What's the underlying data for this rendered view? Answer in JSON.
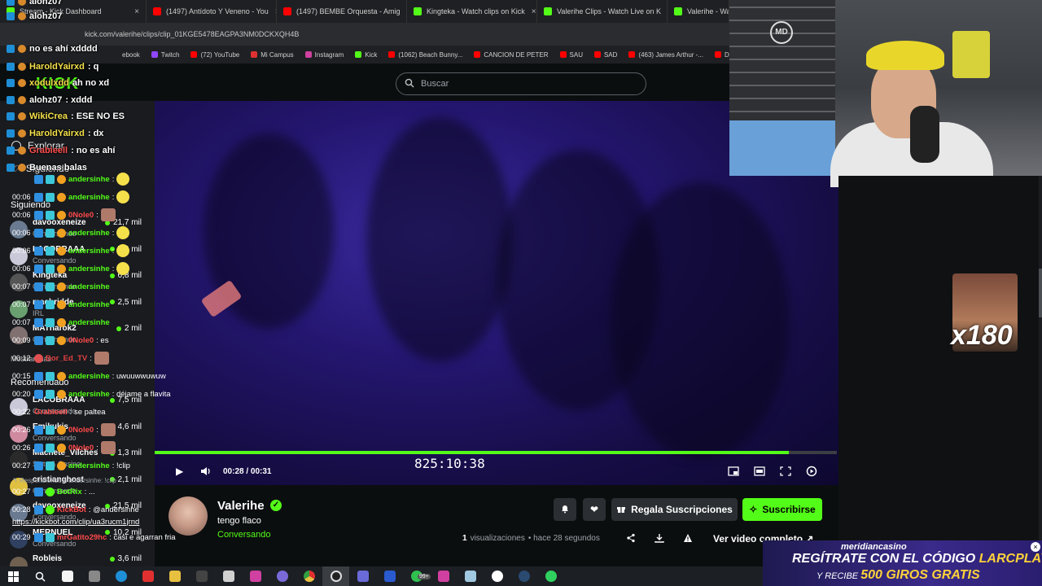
{
  "browser": {
    "tabs": [
      {
        "label": "Stream - Kick Dashboard",
        "color": "#53fc18"
      },
      {
        "label": "(1497) Antídoto Y Veneno - You",
        "color": "#ff0000"
      },
      {
        "label": "(1497) BEMBE Orquesta - Amig",
        "color": "#ff0000"
      },
      {
        "label": "Kingteka - Watch clips on Kick",
        "color": "#53fc18"
      },
      {
        "label": "Valerihe Clips - Watch Live on K",
        "color": "#53fc18"
      },
      {
        "label": "Valerihe - Watch",
        "color": "#53fc18"
      }
    ],
    "url": "kick.com/valerihe/clips/clip_01KGE5478EAGPA3NM0DCKXQH4B",
    "bookmarks": [
      "ebook",
      "Twitch",
      "(72) YouTube",
      "Mi Campus",
      "Instagram",
      "Kick",
      "(1062) Beach Bunny...",
      "CANCION DE PETER",
      "SAU",
      "SAD",
      "(463) James Arthur -...",
      "DRA"
    ]
  },
  "header": {
    "logo": "KICK",
    "search_placeholder": "Buscar"
  },
  "sidebar": {
    "nav": [
      {
        "label": "Explorar"
      },
      {
        "label": "Siguiendo"
      }
    ],
    "following_title": "Siguiendo",
    "following": [
      {
        "name": "davooxeneize",
        "category": "Conversando",
        "viewers": "21,7 mil",
        "color": "#6a7a90"
      },
      {
        "name": "LACOBRAAA",
        "category": "Conversando",
        "viewers": "7,4 mil",
        "color": "#c9c9d9"
      },
      {
        "name": "Kingteka",
        "category": "Conversando",
        "viewers": "6,8 mil",
        "color": "#555"
      },
      {
        "name": "macbridde",
        "category": "IRL",
        "viewers": "2,5 mil",
        "color": "#6aa070"
      },
      {
        "name": "MATnarok2",
        "category": "Conversando",
        "viewers": "2 mil",
        "color": "#807070"
      }
    ],
    "show_more": "Mostrar más",
    "recommended_title": "Recomendado",
    "recommended": [
      {
        "name": "LACOBRAAA",
        "category": "Conversando",
        "viewers": "7,5 mil",
        "color": "#c9c9d9"
      },
      {
        "name": "Emikukis",
        "category": "Conversando",
        "viewers": "4,6 mil",
        "color": "#d08aa0"
      },
      {
        "name": "Machete_Vilches",
        "category": "Slots & Casino",
        "viewers": "1,3 mil",
        "color": "#2a2a2a"
      },
      {
        "name": "cristianghost",
        "category": "Conversando",
        "viewers": "2,1 mil",
        "color": "#e0c040"
      },
      {
        "name": "davooxeneize",
        "category": "Conversando",
        "viewers": "21,5 mil",
        "color": "#6a7a90"
      },
      {
        "name": "MERNUEL",
        "category": "Conversando",
        "viewers": "10,2 mil",
        "color": "#304060"
      },
      {
        "name": "Robleis",
        "category": "",
        "viewers": "3,6 mil",
        "color": "#706050"
      }
    ]
  },
  "overlay_chat": [
    {
      "user": "alohz07",
      "text": ""
    },
    {
      "user": "alohz07",
      "text": ""
    },
    {
      "user": "",
      "text": "no es ahí xdddd"
    },
    {
      "user": "HaroldYairxd",
      "text": ": q"
    },
    {
      "user": "xodulxdd",
      "text": "ah no xd"
    },
    {
      "user": "alohz07",
      "text": ": xddd"
    },
    {
      "user": "WikiCrea",
      "text": ": ESE NO ES"
    },
    {
      "user": "HaroldYairxd",
      "text": ": dx"
    },
    {
      "user": "Grabieell",
      "text": ": no es ahí"
    },
    {
      "user": "",
      "text": "Buenas balas"
    }
  ],
  "video": {
    "big_timer": "825:10:38",
    "time_readout": "00:28 / 00:31",
    "progress": 0.93
  },
  "channel": {
    "name": "Valerihe",
    "clip_title": "tengo flaco",
    "category": "Conversando",
    "gift_label": "Regala Suscripciones",
    "subscribe_label": "Suscribirse",
    "views_count": "1",
    "views_label": "visualizaciones",
    "ago": "• hace 28 segundos",
    "full_video_label": "Ver video completo"
  },
  "webcam": {
    "logo": "MD"
  },
  "chat": [
    {
      "time": "",
      "user": "andersinhe",
      "text": ":",
      "user_class": "u-green",
      "badges": [
        "b1",
        "b2",
        "b3"
      ],
      "emote": "emote"
    },
    {
      "time": "00:06",
      "user": "andersinhe",
      "text": ":",
      "user_class": "u-green",
      "badges": [
        "b1",
        "b2",
        "b3"
      ],
      "emote": "emote"
    },
    {
      "time": "00:06",
      "user": "0Nole0",
      "text": ":",
      "user_class": "u-red",
      "badges": [
        "b1",
        "b2",
        "b3"
      ],
      "emote": "emote2"
    },
    {
      "time": "00:06",
      "user": "andersinhe",
      "text": ":",
      "user_class": "u-green",
      "badges": [
        "b1",
        "b2",
        "b3"
      ],
      "emote": "emote"
    },
    {
      "time": "00:06",
      "user": "andersinhe",
      "text": ":",
      "user_class": "u-green",
      "badges": [
        "b1",
        "b2",
        "b3"
      ],
      "emote": "emote"
    },
    {
      "time": "00:06",
      "user": "andersinhe",
      "text": ":",
      "user_class": "u-green",
      "badges": [
        "b1",
        "b2",
        "b3"
      ],
      "emote": "emote"
    },
    {
      "time": "00:07",
      "user": "andersinhe",
      "text": "",
      "user_class": "u-green",
      "badges": [
        "b1",
        "b2",
        "b3"
      ],
      "emote": ""
    },
    {
      "time": "00:07",
      "user": "andersinhe",
      "text": "",
      "user_class": "u-green",
      "badges": [
        "b1",
        "b2",
        "b3"
      ],
      "emote": ""
    },
    {
      "time": "00:07",
      "user": "andersinhe",
      "text": "",
      "user_class": "u-green",
      "badges": [
        "b1",
        "b2",
        "b3"
      ],
      "emote": ""
    },
    {
      "time": "00:09",
      "user": "0Nole0",
      "text": ": es",
      "user_class": "u-red",
      "badges": [
        "b1",
        "b2",
        "b3"
      ],
      "emote": ""
    },
    {
      "time": "00:12",
      "user": "Bor_Ed_TV",
      "text": ":",
      "user_class": "u-red2",
      "badges": [
        "b5"
      ],
      "emote": "emote2"
    },
    {
      "time": "00:15",
      "user": "andersinhe",
      "text": ": uwuuwwuwuw",
      "user_class": "u-green",
      "badges": [
        "b1",
        "b2",
        "b3"
      ],
      "emote": ""
    },
    {
      "time": "00:20",
      "user": "andersinhe",
      "text": ": déjame a flavita",
      "user_class": "u-green",
      "badges": [
        "b1",
        "b2",
        "b3"
      ],
      "emote": ""
    },
    {
      "time": "00:22",
      "user": "Grabieell",
      "text": ": se paltea",
      "user_class": "u-red",
      "badges": [],
      "emote": ""
    },
    {
      "time": "00:26",
      "user": "0Nole0",
      "text": ":",
      "user_class": "u-red",
      "badges": [
        "b1",
        "b2",
        "b3"
      ],
      "emote": "emote2"
    },
    {
      "time": "00:26",
      "user": "0Nole0",
      "text": ":",
      "user_class": "u-red",
      "badges": [
        "b1",
        "b2",
        "b3"
      ],
      "emote": "emote2"
    },
    {
      "time": "00:27",
      "user": "andersinhe",
      "text": ": !clip",
      "user_class": "u-green",
      "badges": [
        "b1",
        "b2",
        "b3"
      ],
      "emote": ""
    }
  ],
  "chat_tail": {
    "reply_note": "Respondiendo a andersinhe: !clip",
    "botrix_time": "00:27",
    "botrix_user": "BotRix",
    "botrix_text": ": ...",
    "kickbot_time": "00:28",
    "kickbot_user": "KickBot",
    "kickbot_text": ": @andersinhe",
    "kickbot_link": "https://kickbot.com/clip/ua3rucm1jrnd",
    "last_time": "00:29",
    "last_user": "mrGatito29hc",
    "last_text": ": casi e agarran fria",
    "emote_multiplier": "x180"
  },
  "ad": {
    "brand": "meridiancasino",
    "line1_prefix": "REGÍTRATE CON EL CÓDIGO",
    "line1_code": "LARCPLAY",
    "line2_prefix": "Y RECIBE",
    "line2_bonus": "500 GIROS GRATIS"
  },
  "taskbar": {
    "badge": "99+"
  }
}
